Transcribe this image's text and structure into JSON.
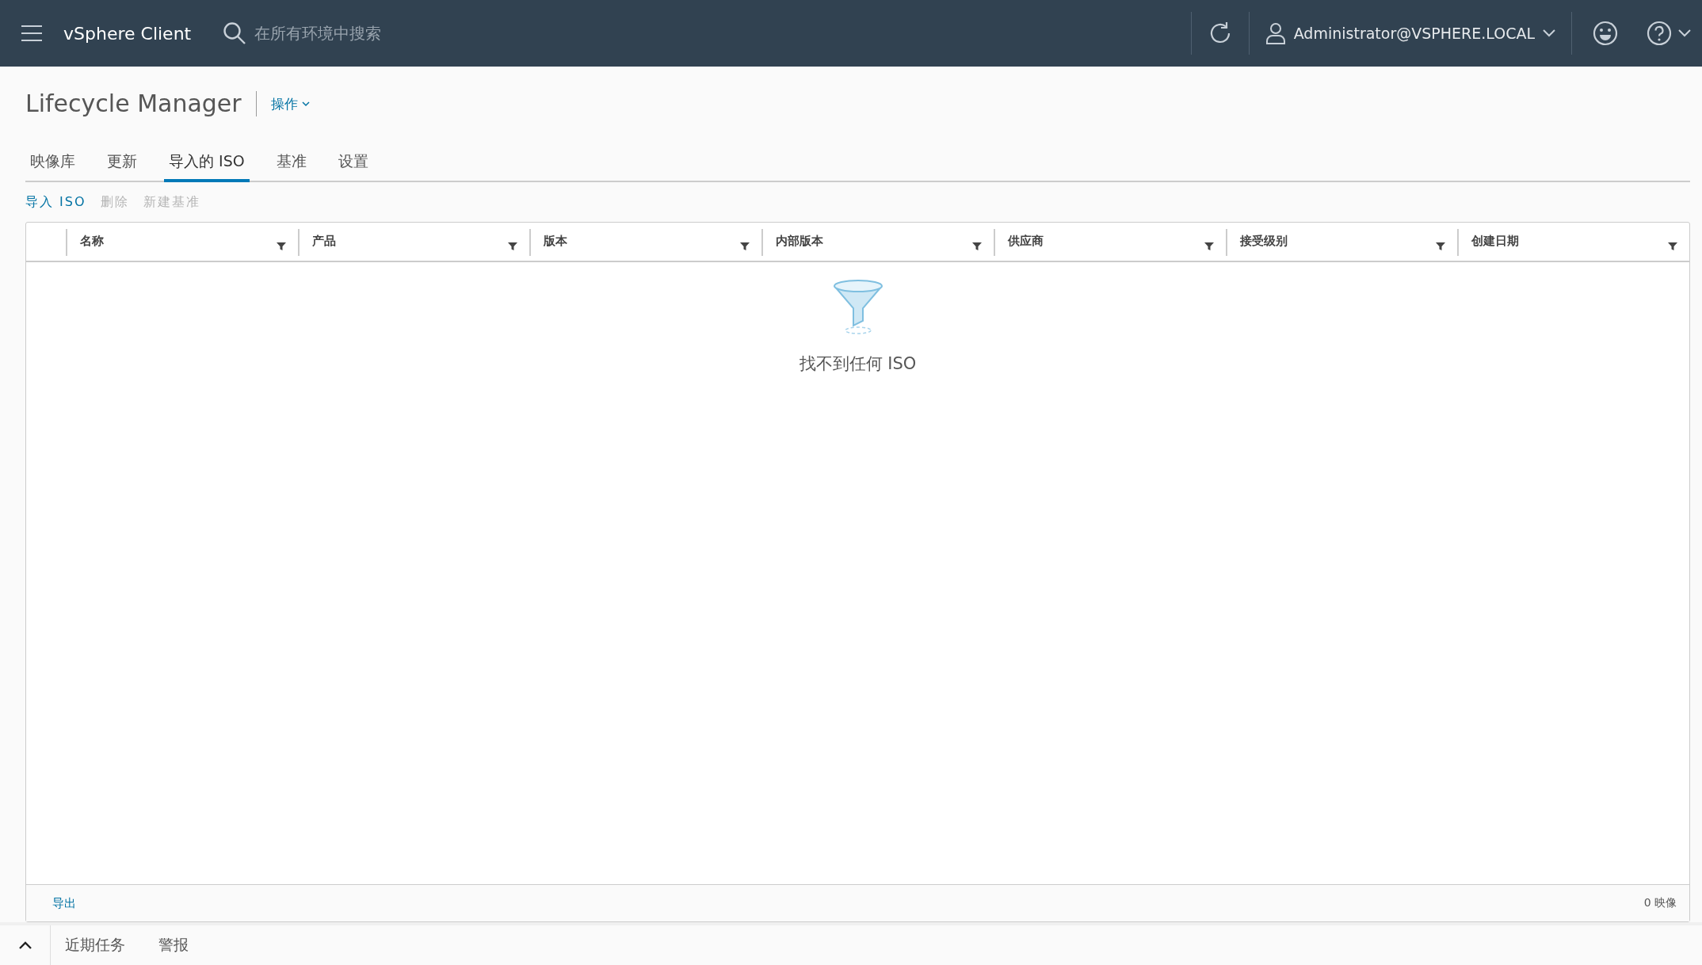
{
  "header": {
    "app_title": "vSphere Client",
    "search": {
      "placeholder": "在所有环境中搜索"
    },
    "user": "Administrator@VSPHERE.LOCAL"
  },
  "page": {
    "title": "Lifecycle Manager",
    "actions_menu": "操作"
  },
  "tabs": [
    {
      "label": "映像库",
      "selected": false
    },
    {
      "label": "更新",
      "selected": false
    },
    {
      "label": "导入的 ISO",
      "selected": true
    },
    {
      "label": "基准",
      "selected": false
    },
    {
      "label": "设置",
      "selected": false
    }
  ],
  "toolbar": [
    {
      "label": "导入 ISO",
      "disabled": false
    },
    {
      "label": "删除",
      "disabled": true
    },
    {
      "label": "新建基准",
      "disabled": true
    }
  ],
  "table": {
    "columns": [
      "名称",
      "产品",
      "版本",
      "内部版本",
      "供应商",
      "接受级别",
      "创建日期"
    ],
    "empty_message": "找不到任何 ISO",
    "export": "导出",
    "count": "0 映像"
  },
  "bottom_bar": {
    "tabs": [
      "近期任务",
      "警报"
    ]
  }
}
